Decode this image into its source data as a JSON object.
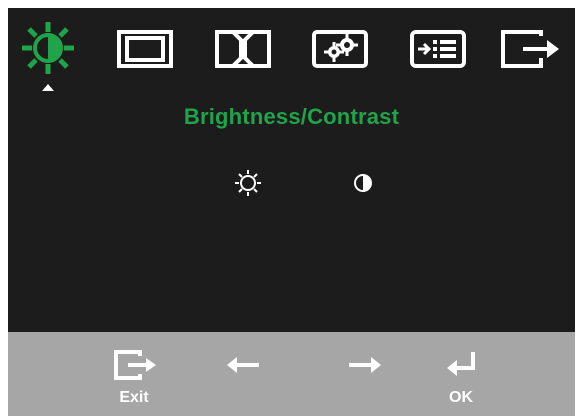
{
  "menu": {
    "tabs": [
      {
        "id": "brightness-contrast",
        "icon": "brightness-contrast-icon",
        "selected": true
      },
      {
        "id": "image-position",
        "icon": "image-position-icon",
        "selected": false
      },
      {
        "id": "image-setup",
        "icon": "image-setup-icon",
        "selected": false
      },
      {
        "id": "image-properties",
        "icon": "image-properties-icon",
        "selected": false
      },
      {
        "id": "options",
        "icon": "options-icon",
        "selected": false
      },
      {
        "id": "exit",
        "icon": "exit-icon",
        "selected": false
      }
    ],
    "title": "Brightness/Contrast",
    "sub_items": [
      {
        "id": "brightness",
        "icon": "sun-icon"
      },
      {
        "id": "contrast",
        "icon": "contrast-icon"
      }
    ]
  },
  "footer": {
    "exit_label": "Exit",
    "ok_label": "OK",
    "buttons": [
      "exit-icon",
      "left-arrow-icon",
      "right-arrow-icon",
      "enter-icon"
    ]
  },
  "colors": {
    "accent": "#20a34a",
    "background": "#1d1c1c",
    "footer": "#a6a6a6",
    "icon": "#ffffff"
  }
}
